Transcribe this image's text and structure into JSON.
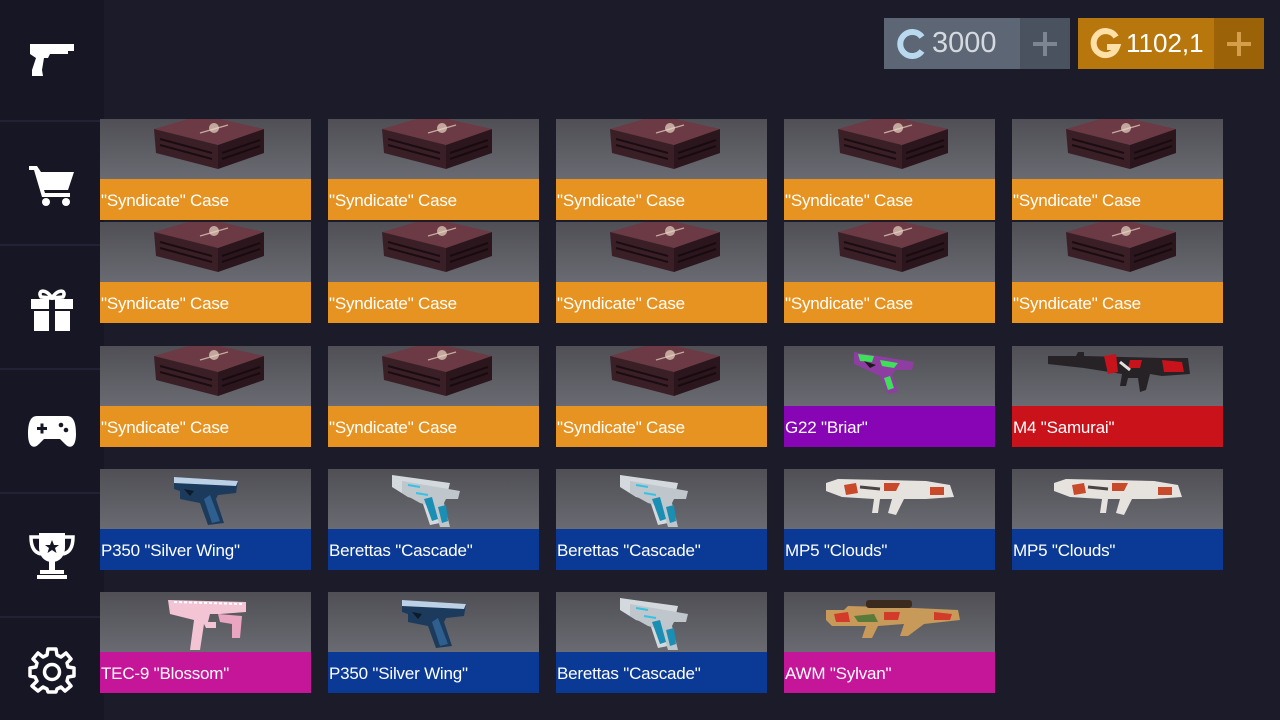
{
  "sidebar": {
    "items": [
      {
        "name": "pistol-icon"
      },
      {
        "name": "cart-icon"
      },
      {
        "name": "gift-icon"
      },
      {
        "name": "gamepad-icon"
      },
      {
        "name": "trophy-icon"
      },
      {
        "name": "gear-icon"
      }
    ]
  },
  "currency": {
    "credits": {
      "value": "3000",
      "icon_letter": "C",
      "plus": "+"
    },
    "gold": {
      "value": "1102,1",
      "icon_letter": "G",
      "plus": "+"
    }
  },
  "rarity_colors": {
    "orange": "#e69321",
    "purple": "#8705b5",
    "red": "#ca121b",
    "blue": "#0b3a96",
    "pink": "#c5169a"
  },
  "inventory": [
    {
      "label": "\"Syndicate\" Case",
      "rarity": "orange",
      "kind": "case"
    },
    {
      "label": "\"Syndicate\" Case",
      "rarity": "orange",
      "kind": "case"
    },
    {
      "label": "\"Syndicate\" Case",
      "rarity": "orange",
      "kind": "case"
    },
    {
      "label": "\"Syndicate\" Case",
      "rarity": "orange",
      "kind": "case"
    },
    {
      "label": "\"Syndicate\" Case",
      "rarity": "orange",
      "kind": "case"
    },
    {
      "label": "\"Syndicate\" Case",
      "rarity": "orange",
      "kind": "case"
    },
    {
      "label": "\"Syndicate\" Case",
      "rarity": "orange",
      "kind": "case"
    },
    {
      "label": "\"Syndicate\" Case",
      "rarity": "orange",
      "kind": "case"
    },
    {
      "label": "\"Syndicate\" Case",
      "rarity": "orange",
      "kind": "case"
    },
    {
      "label": "\"Syndicate\" Case",
      "rarity": "orange",
      "kind": "case"
    },
    {
      "label": "\"Syndicate\" Case",
      "rarity": "orange",
      "kind": "case"
    },
    {
      "label": "\"Syndicate\" Case",
      "rarity": "orange",
      "kind": "case"
    },
    {
      "label": "\"Syndicate\" Case",
      "rarity": "orange",
      "kind": "case"
    },
    {
      "label": "G22 \"Briar\"",
      "rarity": "purple",
      "kind": "pistol-green"
    },
    {
      "label": "M4 \"Samurai\"",
      "rarity": "red",
      "kind": "rifle-red"
    },
    {
      "label": "P350 \"Silver Wing\"",
      "rarity": "blue",
      "kind": "pistol-blue"
    },
    {
      "label": "Berettas \"Cascade\"",
      "rarity": "blue",
      "kind": "dual-pistols"
    },
    {
      "label": "Berettas \"Cascade\"",
      "rarity": "blue",
      "kind": "dual-pistols"
    },
    {
      "label": "MP5 \"Clouds\"",
      "rarity": "blue",
      "kind": "smg"
    },
    {
      "label": "MP5 \"Clouds\"",
      "rarity": "blue",
      "kind": "smg"
    },
    {
      "label": "TEC-9 \"Blossom\"",
      "rarity": "pink",
      "kind": "tec9"
    },
    {
      "label": "P350 \"Silver Wing\"",
      "rarity": "blue",
      "kind": "pistol-blue"
    },
    {
      "label": "Berettas \"Cascade\"",
      "rarity": "blue",
      "kind": "dual-pistols"
    },
    {
      "label": "AWM \"Sylvan\"",
      "rarity": "pink",
      "kind": "sniper"
    }
  ]
}
